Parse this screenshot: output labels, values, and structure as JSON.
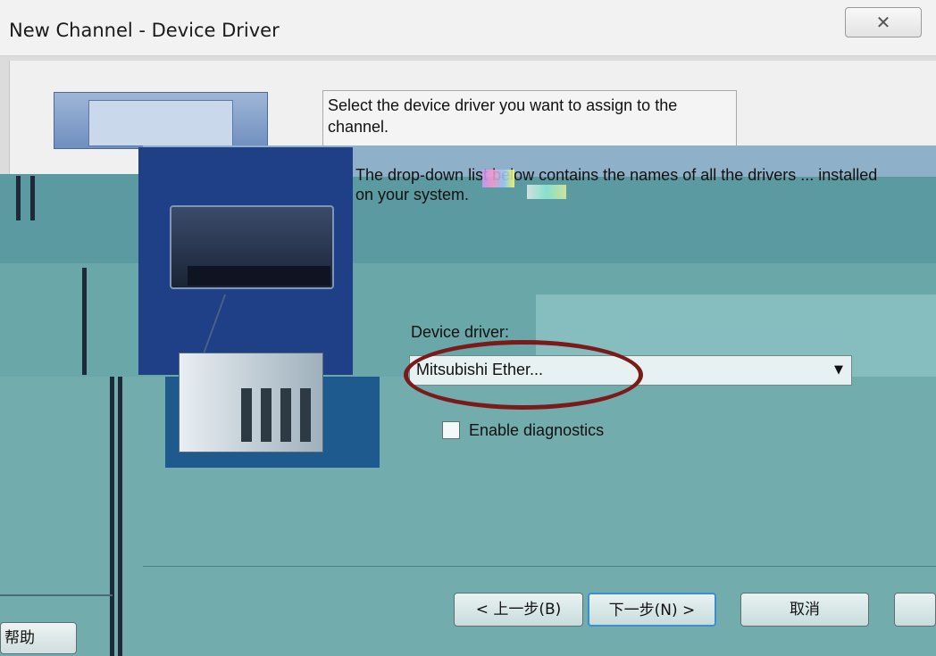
{
  "window": {
    "title": "New Channel - Device Driver",
    "close_glyph": "✕"
  },
  "instructions": {
    "line1": "Select the device driver you want to assign to the channel.",
    "line2": "The drop-down list below contains the names of all the drivers ... installed on your system."
  },
  "device_driver": {
    "label": "Device driver:",
    "selected_value": "Mitsubishi Ether...",
    "dropdown_icon": "chevron-down-icon"
  },
  "diagnostics": {
    "label": "Enable diagnostics",
    "checked": false
  },
  "buttons": {
    "back": "< 上一步(B)",
    "next": "下一步(N) >",
    "cancel": "取消",
    "help": "帮助"
  },
  "colors": {
    "highlight_ellipse": "#7a1a1a",
    "overlay": "#6aa7a8",
    "focus_border": "#3a8fd0"
  }
}
